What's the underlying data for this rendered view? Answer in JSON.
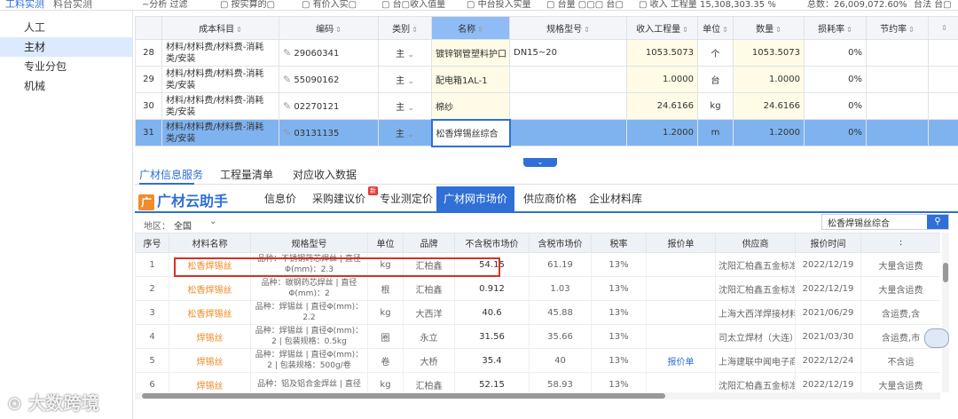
{
  "topbar": {
    "tab1": "工料实测",
    "tab2": "料台实测",
    "tools": [
      "∼分析 过滤",
      "▢ 按实算的▢",
      "▢ 有价入实▢",
      "▢ 台▢收入值量",
      "▢ 中台投入实量",
      "▢ 台量 ▢▢▢ 台▢",
      "▢ 收入 工程量 15,308,303.35 %",
      "总数：26,009,072.60%",
      "台法 台▢"
    ]
  },
  "sidebar": {
    "items": [
      "人工",
      "主材",
      "专业分包",
      "机械"
    ]
  },
  "upper": {
    "headers": [
      "",
      "成本科目",
      "编码",
      "类别",
      "名称",
      "规格型号",
      "收入工程量",
      "单位",
      "数量",
      "损耗率",
      "节约率",
      ""
    ],
    "rows": [
      {
        "no": "28",
        "subject": "材料/材料费/材料费-消耗类/安装",
        "code": "29060341",
        "cat": "主",
        "name": "镀锌钢管塑料护口",
        "spec": "DN15~20",
        "qty_in": "1053.5073",
        "unit": "个",
        "qty": "1053.5073",
        "loss": "0%",
        "save": ""
      },
      {
        "no": "29",
        "subject": "材料/材料费/材料费-消耗类/安装",
        "code": "55090162",
        "cat": "主",
        "name": "配电箱1AL-1",
        "spec": "",
        "qty_in": "1.0000",
        "unit": "台",
        "qty": "1.0000",
        "loss": "0%",
        "save": ""
      },
      {
        "no": "30",
        "subject": "材料/材料费/材料费-消耗类/安装",
        "code": "02270121",
        "cat": "主",
        "name": "棉纱",
        "spec": "",
        "qty_in": "24.6166",
        "unit": "kg",
        "qty": "24.6166",
        "loss": "0%",
        "save": ""
      },
      {
        "no": "31",
        "subject": "材料/材料费/材料费-消耗类/安装",
        "code": "03131135",
        "cat": "主",
        "name": "松香焊锡丝综合",
        "spec": "",
        "qty_in": "1.2000",
        "unit": "m",
        "qty": "1.2000",
        "loss": "0%",
        "save": ""
      }
    ]
  },
  "pager": "⌄",
  "info_tabs": [
    "广材信息服务",
    "工程量清单",
    "对应收入数据"
  ],
  "brand": {
    "logo_box": "广",
    "logo_text": "广材云助手",
    "tabs": [
      "信息价",
      "采购建议价",
      "专业测定价",
      "广材网市场价",
      "供应商价格",
      "企业材料库"
    ],
    "new_badge": "新"
  },
  "region": {
    "label": "地区：",
    "value": "全国",
    "chevron": "⌄"
  },
  "search": {
    "value": "松香焊锡丝综合",
    "button": "⚲"
  },
  "lower": {
    "headers": [
      "序号",
      "材料名称",
      "规格型号",
      "单位",
      "品牌",
      "不含税市场价",
      "含税市场价",
      "税率",
      "报价单",
      "供应商",
      "报价时间",
      ":"
    ],
    "rows": [
      {
        "no": "1",
        "name": "松香焊锡丝",
        "spec": "品种：不锈钢药芯焊丝 | 直径Φ(mm)：2.3",
        "unit": "kg",
        "brand": "汇柏鑫",
        "ex": "54.15",
        "inc": "61.19",
        "tax": "13%",
        "quote": "",
        "supplier": "沈阳汇柏鑫五金标准...",
        "date": "2022/12/19",
        "extra": "大量含运费"
      },
      {
        "no": "2",
        "name": "松香焊锡丝",
        "spec": "品种：碳钢药芯焊丝 | 直径Φ(mm)：2",
        "unit": "根",
        "brand": "汇柏鑫",
        "ex": "0.912",
        "inc": "1.03",
        "tax": "13%",
        "quote": "",
        "supplier": "沈阳汇柏鑫五金标准...",
        "date": "2022/12/19",
        "extra": "大量含运费"
      },
      {
        "no": "3",
        "name": "松香焊锡丝",
        "spec": "品种：焊锡丝 | 直径Φ(mm)：2.2",
        "unit": "kg",
        "brand": "大西洋",
        "ex": "40.6",
        "inc": "45.88",
        "tax": "13%",
        "quote": "",
        "supplier": "上海大西洋焊接材料...",
        "date": "2021/06/29",
        "extra": "含运费,含"
      },
      {
        "no": "4",
        "name": "焊锡丝",
        "spec": "品种：焊锡丝 | 直径Φ(mm)：2 | 包装规格：0.5kg",
        "unit": "圈",
        "brand": "永立",
        "ex": "31.56",
        "inc": "35.66",
        "tax": "13%",
        "quote": "",
        "supplier": "司太立焊材（大连）...",
        "date": "2021/03/30",
        "extra": "含运费,市"
      },
      {
        "no": "5",
        "name": "焊锡丝",
        "spec": "品种：焊锡丝 | 直径Φ(mm)：2 | 包装规格：500g/卷",
        "unit": "卷",
        "brand": "大桥",
        "ex": "35.4",
        "inc": "40",
        "tax": "13%",
        "quote": "报价单",
        "supplier": "上海建联中闻电子商...",
        "date": "2022/12/24",
        "extra": "不含运"
      },
      {
        "no": "6",
        "name": "焊锡丝",
        "spec": "品种：铝及铝合金焊丝 | 直径",
        "unit": "kg",
        "brand": "汇柏鑫",
        "ex": "52.15",
        "inc": "58.93",
        "tax": "13%",
        "quote": "",
        "supplier": "沈阳汇柏鑫五金标准...",
        "date": "2022/12/19",
        "extra": "大量含运费"
      }
    ]
  },
  "watermark": "⊙ 大数跨境"
}
